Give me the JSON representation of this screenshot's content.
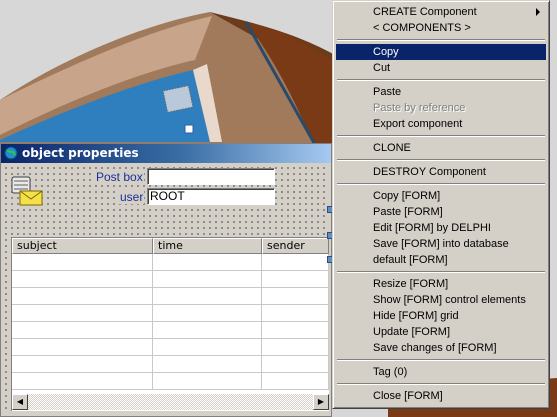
{
  "window": {
    "title": "object properties",
    "postbox_label": "Post box",
    "postbox_value": "",
    "user_label": "user",
    "user_value": "ROOT",
    "columns": [
      "subject",
      "time",
      "sender"
    ],
    "row_count": 8
  },
  "context_menu": {
    "items": [
      {
        "label": "CREATE Component",
        "has_submenu": true
      },
      {
        "label": "< COMPONENTS >"
      },
      {
        "separator": true
      },
      {
        "label": "Copy",
        "selected": true
      },
      {
        "label": "Cut"
      },
      {
        "separator": true
      },
      {
        "label": "Paste"
      },
      {
        "label": "Paste by reference",
        "disabled": true
      },
      {
        "label": "Export component"
      },
      {
        "separator": true
      },
      {
        "label": "CLONE"
      },
      {
        "separator": true
      },
      {
        "label": "DESTROY Component"
      },
      {
        "separator": true
      },
      {
        "label": "Copy [FORM]"
      },
      {
        "label": "Paste [FORM]"
      },
      {
        "label": "Edit [FORM] by DELPHI"
      },
      {
        "label": "Save [FORM] into database"
      },
      {
        "label": "default [FORM]"
      },
      {
        "separator": true
      },
      {
        "label": "Resize [FORM]"
      },
      {
        "label": "Show [FORM] control elements"
      },
      {
        "label": "Hide [FORM] grid"
      },
      {
        "label": "Update [FORM]"
      },
      {
        "label": "Save changes of [FORM]"
      },
      {
        "separator": true
      },
      {
        "label": "Tag (0)"
      },
      {
        "separator": true
      },
      {
        "label": "Close [FORM]"
      }
    ]
  },
  "colors": {
    "title_gradient_start": "#0a246a",
    "menu_selection": "#0a246a",
    "label_blue": "#1a2e9e",
    "face": "#d4d0c8"
  },
  "icons": {
    "title_icon": "globe-icon",
    "mail_icon": "mailbox-envelope-icon"
  }
}
